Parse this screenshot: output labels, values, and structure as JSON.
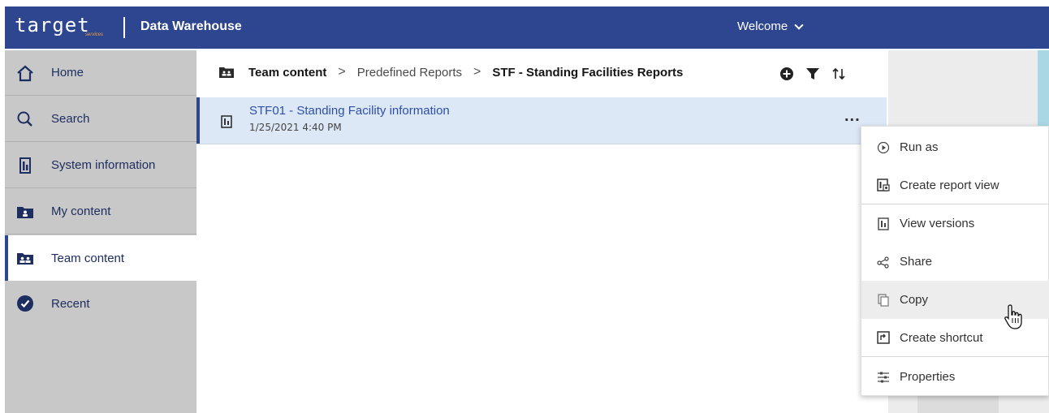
{
  "header": {
    "logo_text": "target",
    "logo_sub": "services",
    "app_title": "Data Warehouse",
    "welcome_label": "Welcome"
  },
  "sidebar": {
    "items": [
      {
        "label": "Home",
        "icon": "home-icon"
      },
      {
        "label": "Search",
        "icon": "search-icon"
      },
      {
        "label": "System information",
        "icon": "report-icon"
      },
      {
        "label": "My content",
        "icon": "my-folder-icon"
      },
      {
        "label": "Team content",
        "icon": "team-folder-icon",
        "active": true
      },
      {
        "label": "Recent",
        "icon": "recent-icon"
      }
    ]
  },
  "breadcrumb": {
    "root": "Team content",
    "middle": "Predefined Reports",
    "current": "STF - Standing Facilities Reports"
  },
  "toolbar": {
    "icons": [
      "add-icon",
      "filter-icon",
      "sort-icon"
    ]
  },
  "list": {
    "rows": [
      {
        "title": "STF01 - Standing Facility information",
        "date": "1/25/2021 4:40 PM",
        "more": "..."
      }
    ]
  },
  "context_menu": {
    "items": [
      {
        "label": "Run as",
        "icon": "run-icon"
      },
      {
        "label": "Create report view",
        "icon": "report-view-icon"
      },
      {
        "label": "View versions",
        "icon": "versions-icon"
      },
      {
        "label": "Share",
        "icon": "share-icon"
      },
      {
        "label": "Copy",
        "icon": "copy-icon",
        "hovered": true
      },
      {
        "label": "Create shortcut",
        "icon": "shortcut-icon"
      },
      {
        "label": "Properties",
        "icon": "properties-icon"
      }
    ]
  },
  "colors": {
    "brand": "#2e4590",
    "sidebar_bg": "#c8c8c8",
    "selected_row": "#dde8f6",
    "link": "#2e4fa8",
    "logo_accent": "#f2a23a"
  }
}
